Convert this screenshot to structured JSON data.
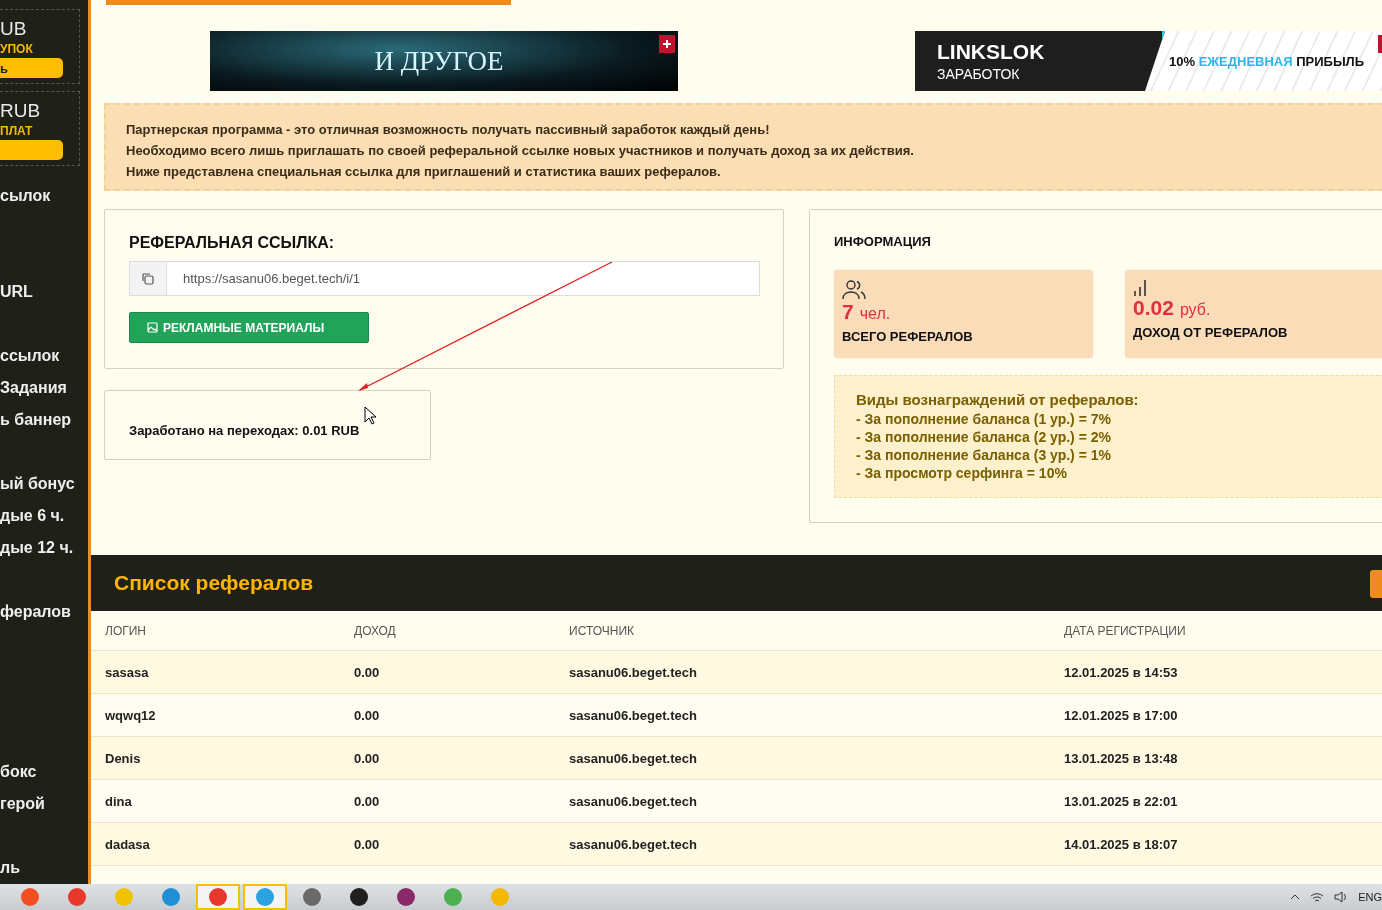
{
  "sidebar": {
    "wallets": [
      {
        "amount": "UB",
        "label": "УПОК",
        "button": "ь"
      },
      {
        "amount": "RUB",
        "label": "ПЛАТ"
      }
    ],
    "menu": [
      "сылок",
      "URL",
      "ссылок",
      "Задания",
      "ь баннер",
      "ый бонус",
      "дые 6 ч.",
      "дые 12 ч.",
      "фералов",
      "бокс",
      "герой",
      "ль"
    ]
  },
  "banners": [
    {
      "kind": "art",
      "title": "И ДРУГОЕ"
    },
    {
      "kind": "promo",
      "title": "LINKSLOK",
      "subtitle": "ЗАРАБОТОК",
      "prefix": "10%",
      "highlight": "ЕЖЕДНЕВНАЯ",
      "suffix": "ПРИБЫЛЬ"
    }
  ],
  "notice": [
    "Партнерская программа - это отличная возможность получать пассивный заработок каждый день!",
    "Необходимо всего лишь приглашать по своей реферальной ссылке новых участников и получать доход за их действия.",
    "Ниже представлена специальная ссылка для приглашений и статистика ваших рефералов."
  ],
  "referral_link": {
    "title": "РЕФЕРАЛЬНАЯ ССЫЛКА:",
    "value": "https://sasanu06.beget.tech/i/1",
    "button": "РЕКЛАМНЫЕ МАТЕРИАЛЫ"
  },
  "earned": "Заработано на переходах: 0.01 RUB",
  "info": {
    "title": "ИНФОРМАЦИЯ",
    "stats": [
      {
        "kind": "users",
        "value": "7",
        "unit": "чел.",
        "label": "ВСЕГО РЕФЕРАЛОВ"
      },
      {
        "kind": "bars",
        "value": "0.02",
        "unit": "руб.",
        "label": "ДОХОД ОТ РЕФЕРАЛОВ"
      }
    ],
    "rewards_title": "Виды вознаграждений от рефералов:",
    "rewards": [
      "- За пополнение баланса (1 ур.) = 7%",
      "- За пополнение баланса (2 ур.) = 2%",
      "- За пополнение баланса (3 ур.) = 1%",
      "- За просмотр серфинга = 10%"
    ]
  },
  "table": {
    "title": "Список рефералов",
    "columns": [
      "ЛОГИН",
      "ДОХОД",
      "ИСТОЧНИК",
      "ДАТА РЕГИСТРАЦИИ"
    ],
    "rows": [
      [
        "sasasa",
        "0.00",
        "sasanu06.beget.tech",
        "12.01.2025 в 14:53"
      ],
      [
        "wqwq12",
        "0.00",
        "sasanu06.beget.tech",
        "12.01.2025 в 17:00"
      ],
      [
        "Denis",
        "0.00",
        "sasanu06.beget.tech",
        "13.01.2025 в 13:48"
      ],
      [
        "dina",
        "0.00",
        "sasanu06.beget.tech",
        "13.01.2025 в 22:01"
      ],
      [
        "dadasa",
        "0.00",
        "sasanu06.beget.tech",
        "14.01.2025 в 18:07"
      ]
    ]
  },
  "taskbar": {
    "apps": [
      {
        "color": "#f25022",
        "selected": false
      },
      {
        "color": "#e8382c",
        "selected": false
      },
      {
        "color": "#f2c200",
        "selected": false
      },
      {
        "color": "#1f8fd6",
        "selected": false
      },
      {
        "color": "#e8382c",
        "selected": true
      },
      {
        "color": "#2aa3de",
        "selected": true
      },
      {
        "color": "#6a6a6a",
        "selected": false
      },
      {
        "color": "#202020",
        "selected": false
      },
      {
        "color": "#8a2a6a",
        "selected": false
      },
      {
        "color": "#4caf50",
        "selected": false
      },
      {
        "color": "#f5b800",
        "selected": false
      }
    ],
    "language": "ENG"
  }
}
